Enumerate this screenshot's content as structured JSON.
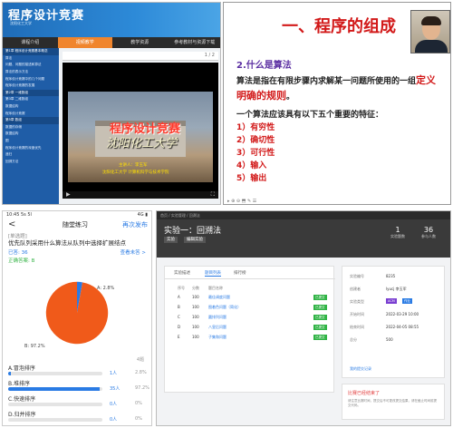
{
  "panel1": {
    "title": "程序设计竞赛",
    "subtitle": "沈阳化工大学",
    "tabs": [
      "课程介绍",
      "视频教学",
      "教学资源",
      "参考教材与资源下载"
    ],
    "active_tab": 1,
    "sidebar": [
      "第1章 程序设计竞赛基本概念",
      "算法",
      "问题、问题的描述和算法",
      "算法的表示方法",
      "程序设计竞赛中的几个问题",
      "程序设计竞赛的发展",
      "第2章 一维数组",
      "第3章 二维数组",
      "数据结构",
      "程序设计竞赛",
      "第5章 数组",
      "数据的存储",
      "数据结构",
      "图",
      "程序设计竞赛的深度优先",
      "递归",
      "回溯方法"
    ],
    "video": {
      "title": "程序设计竞赛",
      "calligraphy": "沈阳化工大学",
      "speaker": "主讲人：李玉军",
      "affiliation": "沈阳化工大学 计算机科学与技术学院"
    },
    "top_controls": "1 / 2"
  },
  "panel2": {
    "title": "一、程序的组成",
    "heading": "2.什么是算法",
    "para_prefix": "算法是指在有限步骤内求解某一问题所使用的一组",
    "para_red": "定义明确的规则",
    "para_suffix": "。",
    "list_intro": "一个算法应该具有以下五个重要的特征：",
    "features": [
      "1）有穷性",
      "2）确切性",
      "3）可行性",
      "4）输入",
      "5）输出"
    ],
    "toolbar": "▸ ⊕ ⊖ ⬒ ✎ ☰"
  },
  "panel3": {
    "status_time": "10:45 5s 5l",
    "status_right": "4G ▮",
    "nav_back": "<",
    "nav_title": "随堂练习",
    "nav_right": "再次发布",
    "tag": "[单选题]",
    "question": "优先队列采用什么算法从队列中选择扩展结点",
    "answered_label": "已答: 36",
    "detail_link": "查看未答 >",
    "correct_answer": "正确答案: B",
    "pie_label_a": "A: 2.8%",
    "pie_label_b": "B: 97.2%",
    "page_num": "4题",
    "options": [
      {
        "name": "A.冒泡排序",
        "count": "1人",
        "percent": "2.8%",
        "value": 2.8
      },
      {
        "name": "B.堆排序",
        "count": "35人",
        "percent": "97.2%",
        "value": 97.2
      },
      {
        "name": "C.快速排序",
        "count": "0人",
        "percent": "0%",
        "value": 0
      },
      {
        "name": "D.归并排序",
        "count": "0人",
        "percent": "0%",
        "value": 0
      }
    ],
    "colors": {
      "a": "#2a7be4",
      "b": "#f05a1a"
    }
  },
  "panel4": {
    "crumb": "首页 / 实验管理 / 回溯法",
    "title": "实验一：回溯法",
    "btn1": "实验",
    "btn2": "编辑实验",
    "stats": [
      {
        "value": "1",
        "label": "实验题数"
      },
      {
        "value": "36",
        "label": "参与人数"
      }
    ],
    "tabs": [
      "实验描述",
      "题目列表",
      "排行榜"
    ],
    "active_tab": 1,
    "table_header": [
      "序号",
      "分数",
      "题目名称"
    ],
    "rows": [
      {
        "id": "A",
        "score": "100",
        "name": "最佳调度问题",
        "status": "已提交"
      },
      {
        "id": "B",
        "score": "100",
        "name": "图着色问题（简化）",
        "status": "已提交"
      },
      {
        "id": "C",
        "score": "100",
        "name": "圆排列问题",
        "status": "已提交"
      },
      {
        "id": "D",
        "score": "100",
        "name": "八皇后问题",
        "status": "已提交"
      },
      {
        "id": "E",
        "score": "100",
        "name": "子集和问题",
        "status": "已提交"
      }
    ],
    "info": [
      {
        "key": "实验编号",
        "value": "8235"
      },
      {
        "key": "创建者",
        "value": "lyucj 李玉军"
      },
      {
        "key": "实验类型",
        "value": "ACM",
        "pill": "作业"
      },
      {
        "key": "开始时间",
        "value": "2022-03-29 10:00"
      },
      {
        "key": "结束时间",
        "value": "2022-04-05 08:55"
      },
      {
        "key": "总分",
        "value": "500"
      }
    ],
    "info_link": "我的提交记录",
    "warn_title": "比赛已经结束了",
    "warn_text": "请注意比赛时间，提交后不可更改提交结果，请在截止时间前提交代码。"
  }
}
